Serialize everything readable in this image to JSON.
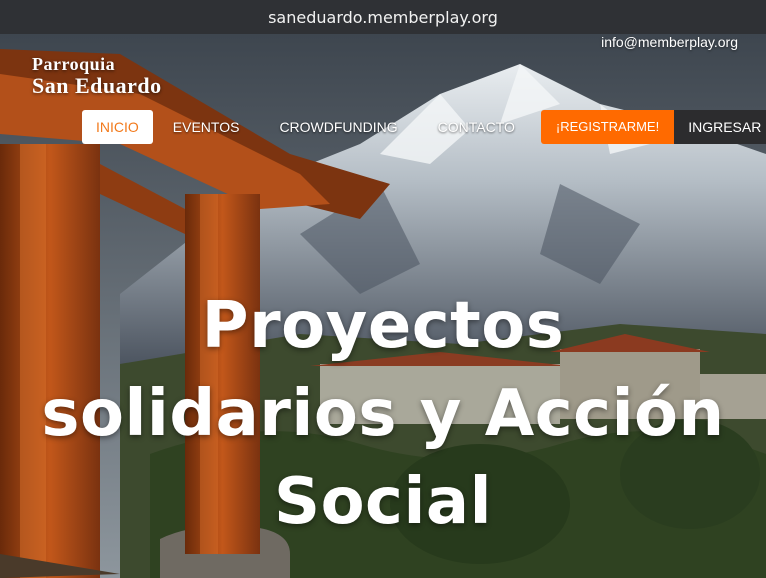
{
  "browser": {
    "url": "saneduardo.memberplay.org"
  },
  "header": {
    "email": "info@memberplay.org",
    "logo_line1": "Parroquia",
    "logo_line2": "San Eduardo"
  },
  "nav": {
    "items": [
      "INICIO",
      "EVENTOS",
      "CROWDFUNDING",
      "CONTACTO"
    ],
    "register_label": "¡REGISTRARME!",
    "login_label": "INGRESAR"
  },
  "hero": {
    "headline_line1": "Proyectos",
    "headline_line2": "solidarios y Acción",
    "headline_line3": "Social"
  },
  "colors": {
    "accent": "#ff6a00",
    "active_text": "#f27a1c",
    "login_bg": "#2c2c2e",
    "urlbar_bg": "#2f3135"
  }
}
